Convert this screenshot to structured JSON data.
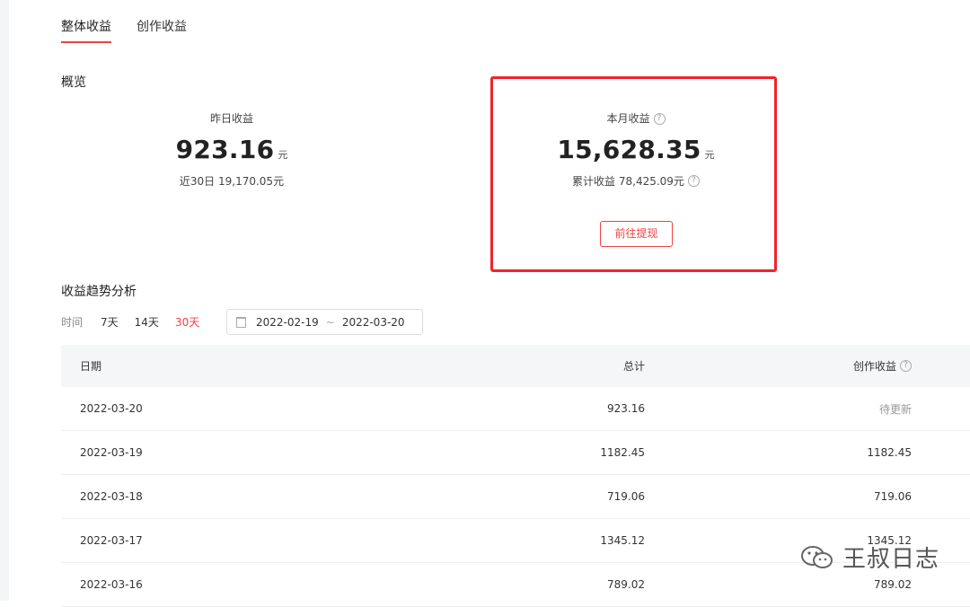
{
  "tabs": [
    {
      "label": "整体收益",
      "active": true
    },
    {
      "label": "创作收益",
      "active": false
    }
  ],
  "overview": {
    "title": "概览",
    "yesterday": {
      "label": "昨日收益",
      "value": "923.16",
      "unit": "元",
      "sub": "近30日 19,170.05元"
    },
    "month": {
      "label": "本月收益",
      "value": "15,628.35",
      "unit": "元",
      "sub": "累计收益 78,425.09元",
      "withdraw_label": "前往提现"
    }
  },
  "trend": {
    "title": "收益趋势分析",
    "time_label": "时间",
    "ranges": [
      {
        "label": "7天",
        "active": false
      },
      {
        "label": "14天",
        "active": false
      },
      {
        "label": "30天",
        "active": true
      }
    ],
    "date_start": "2022-02-19",
    "date_sep": "~",
    "date_end": "2022-03-20"
  },
  "table": {
    "headers": {
      "date": "日期",
      "total": "总计",
      "creation": "创作收益"
    },
    "rows": [
      {
        "date": "2022-03-20",
        "total": "923.16",
        "creation": "待更新"
      },
      {
        "date": "2022-03-19",
        "total": "1182.45",
        "creation": "1182.45"
      },
      {
        "date": "2022-03-18",
        "total": "719.06",
        "creation": "719.06"
      },
      {
        "date": "2022-03-17",
        "total": "1345.12",
        "creation": "1345.12"
      },
      {
        "date": "2022-03-16",
        "total": "789.02",
        "creation": "789.02"
      }
    ]
  },
  "watermark": {
    "text": "王叔日志",
    "icon": "wechat-icon"
  },
  "colors": {
    "accent": "#f04142",
    "highlight": "#f2232a"
  }
}
